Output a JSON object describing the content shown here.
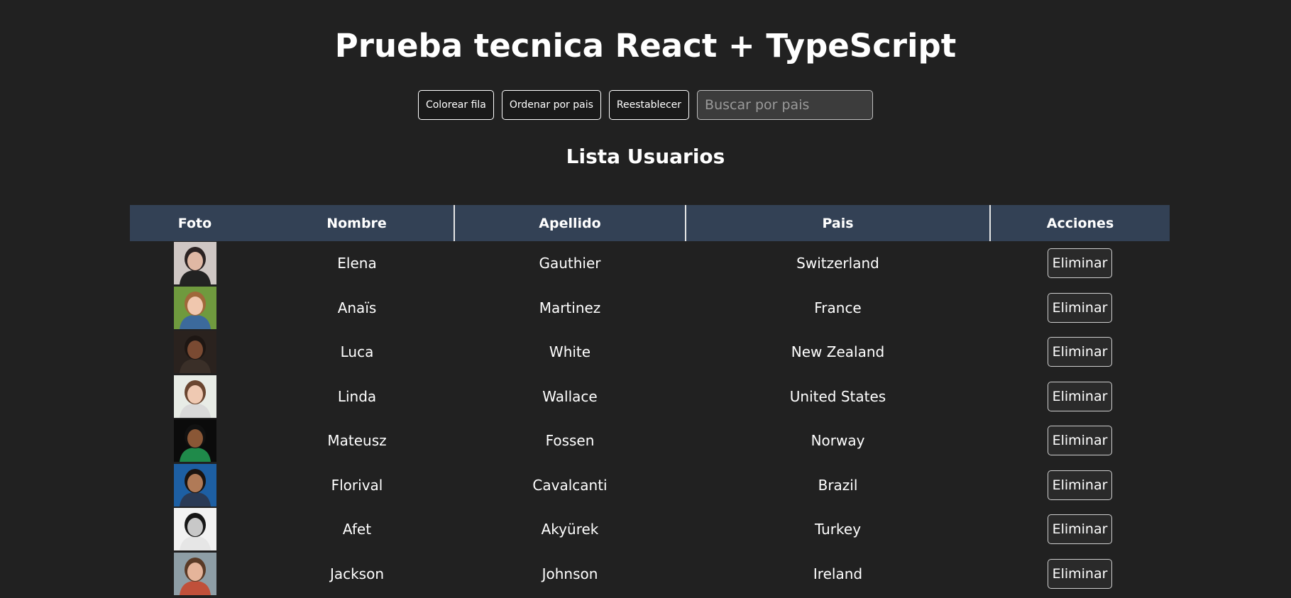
{
  "header": {
    "title": "Prueba tecnica React + TypeScript"
  },
  "toolbar": {
    "color_rows_label": "Colorear fila",
    "sort_by_country_label": "Ordenar por pais",
    "reset_label": "Reestablecer",
    "search_placeholder": "Buscar por pais",
    "search_value": ""
  },
  "list": {
    "title": "Lista Usuarios",
    "columns": [
      "Foto",
      "Nombre",
      "Apellido",
      "Pais",
      "Acciones"
    ],
    "header_color": "#334155",
    "delete_label": "Eliminar",
    "rows": [
      {
        "first": "Elena",
        "last": "Gauthier",
        "country": "Switzerland",
        "photo": {
          "bg": "#cfc7c4",
          "skin": "#e0b8a4",
          "hair": "#2b2222",
          "shirt": "#222222"
        }
      },
      {
        "first": "Anaïs",
        "last": "Martinez",
        "country": "France",
        "photo": {
          "bg": "#6f9a3e",
          "skin": "#f0c7ae",
          "hair": "#a0683a",
          "shirt": "#3c6a9c"
        }
      },
      {
        "first": "Luca",
        "last": "White",
        "country": "New Zealand",
        "photo": {
          "bg": "#2a221e",
          "skin": "#7a4a32",
          "hair": "#1d1613",
          "shirt": "#3a2f28"
        }
      },
      {
        "first": "Linda",
        "last": "Wallace",
        "country": "United States",
        "photo": {
          "bg": "#e8ece6",
          "skin": "#efc9b2",
          "hair": "#6a4630",
          "shirt": "#d9d9d9"
        }
      },
      {
        "first": "Mateusz",
        "last": "Fossen",
        "country": "Norway",
        "photo": {
          "bg": "#0b0b0b",
          "skin": "#8a5736",
          "hair": "#111111",
          "shirt": "#1f8a4a"
        }
      },
      {
        "first": "Florival",
        "last": "Cavalcanti",
        "country": "Brazil",
        "photo": {
          "bg": "#1d5fa3",
          "skin": "#b07a57",
          "hair": "#1b1410",
          "shirt": "#2a3a55"
        }
      },
      {
        "first": "Afet",
        "last": "Akyürek",
        "country": "Turkey",
        "photo": {
          "bg": "#f2f2f2",
          "skin": "#c8c8c8",
          "hair": "#161616",
          "shirt": "#e6e6e6"
        }
      },
      {
        "first": "Jackson",
        "last": "Johnson",
        "country": "Ireland",
        "photo": {
          "bg": "#8e9ea6",
          "skin": "#e5b49a",
          "hair": "#5a3a26",
          "shirt": "#c0503a"
        }
      }
    ]
  }
}
